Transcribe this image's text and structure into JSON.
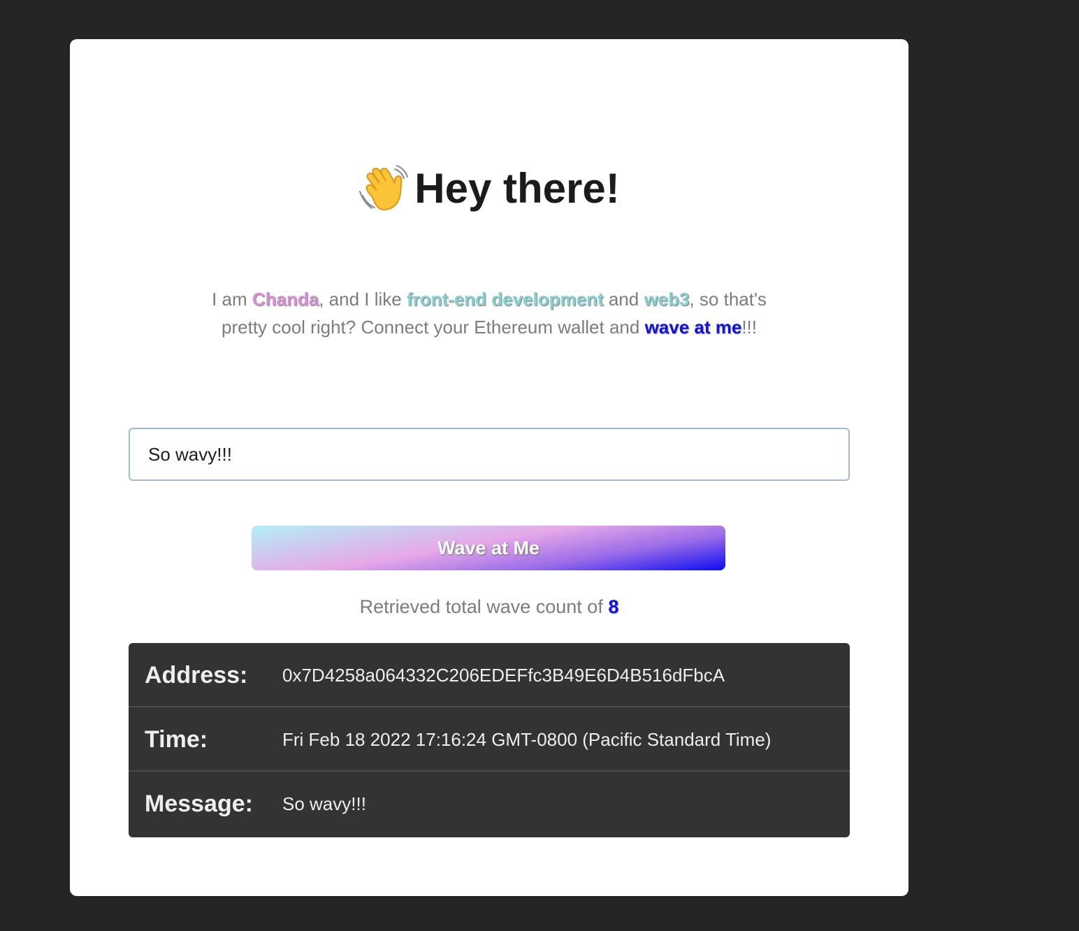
{
  "header": {
    "icon": "waving-hand-icon",
    "title": "Hey there!"
  },
  "bio": {
    "part1": "I am ",
    "name": "Chanda",
    "part2": ", and I like ",
    "interest1": "front-end development",
    "part3": " and ",
    "interest2": "web3",
    "part4": ", so that's pretty cool right? Connect your Ethereum wallet and ",
    "cta": "wave at me",
    "part5": "!!!"
  },
  "message_input": {
    "value": "So wavy!!!"
  },
  "wave_button": {
    "label": "Wave at Me"
  },
  "wave_count": {
    "text": "Retrieved total wave count of ",
    "value": "8"
  },
  "wave_entry": {
    "address_label": "Address:",
    "address": "0x7D4258a064332C206EDEFfc3B49E6D4B516dFbcA",
    "time_label": "Time:",
    "time": "Fri Feb 18 2022 17:16:24 GMT-0800 (Pacific Standard Time)",
    "message_label": "Message:",
    "message": "So wavy!!!"
  },
  "colors": {
    "background": "#252525",
    "card": "#ffffff",
    "highlight_pink": "#d48ed6",
    "highlight_teal": "#88cfcf",
    "highlight_blue": "#1212dd",
    "entry_background": "#333333"
  }
}
